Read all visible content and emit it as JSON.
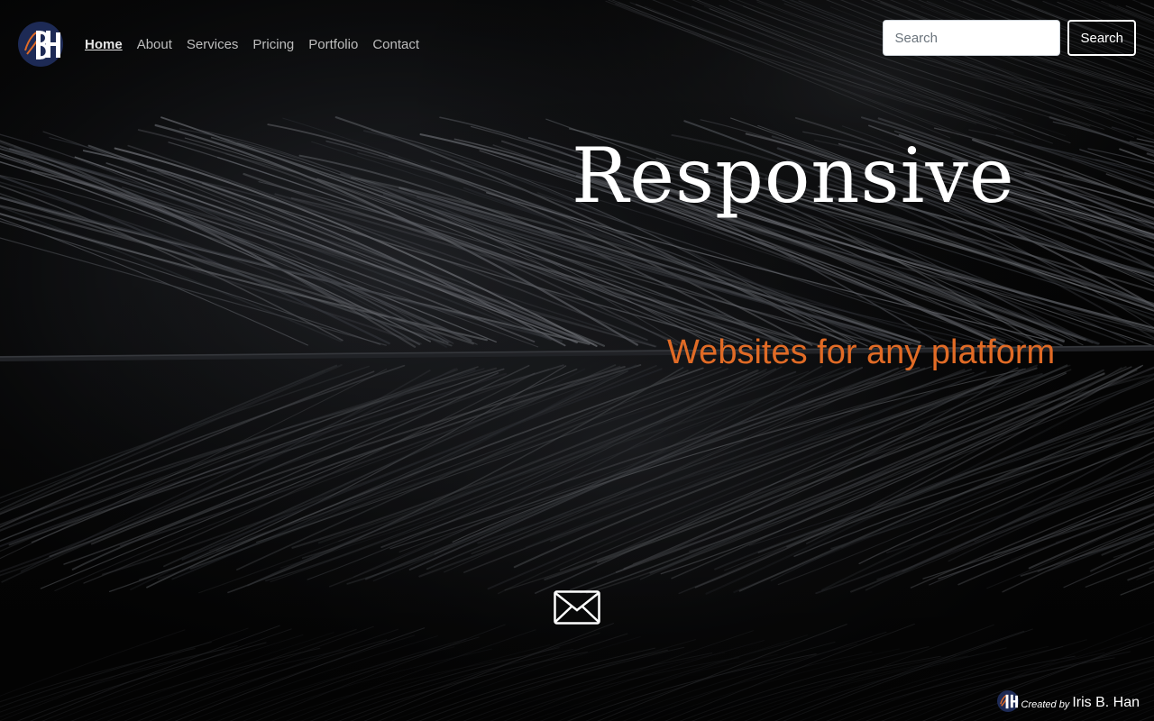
{
  "nav": {
    "links": [
      {
        "label": "Home",
        "active": true
      },
      {
        "label": "About",
        "active": false
      },
      {
        "label": "Services",
        "active": false
      },
      {
        "label": "Pricing",
        "active": false
      },
      {
        "label": "Portfolio",
        "active": false
      },
      {
        "label": "Contact",
        "active": false
      }
    ],
    "logo_icon": "ibh-monogram-icon"
  },
  "search": {
    "placeholder": "Search",
    "value": "",
    "button_label": "Search"
  },
  "hero": {
    "title": "Responsive",
    "subtitle": "Websites for any platform",
    "contact_icon": "envelope-icon"
  },
  "footer": {
    "created_by": "Created by",
    "author": "Iris B. Han"
  },
  "colors": {
    "background": "#050505",
    "accent": "#e16b26",
    "logo_navy": "#1d2a55",
    "text": "#ffffff",
    "nav_text": "#bdbdbd"
  }
}
